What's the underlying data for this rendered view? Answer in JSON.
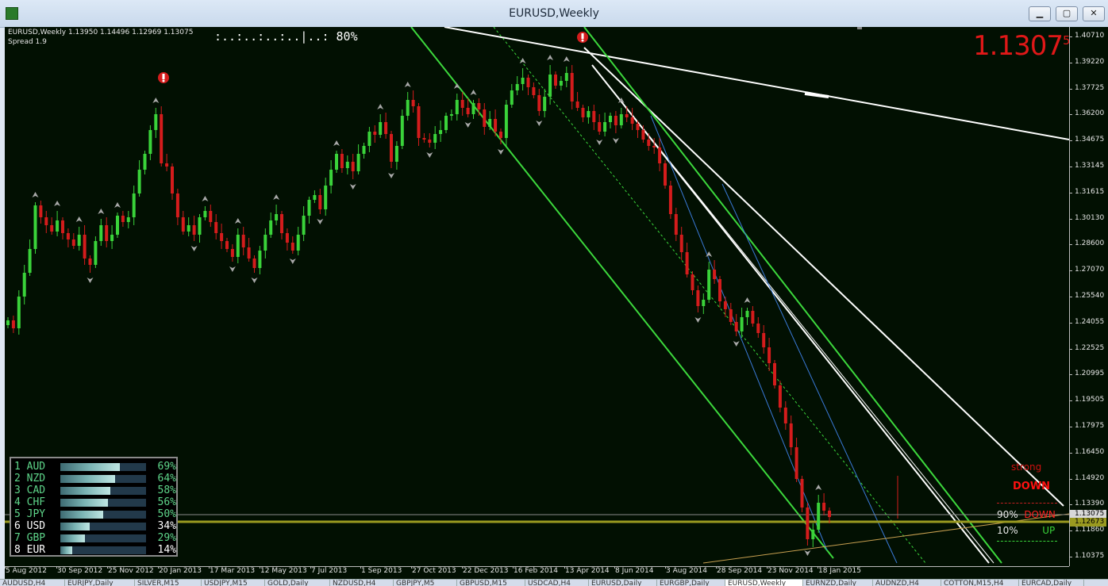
{
  "window": {
    "title": "EURUSD,Weekly",
    "buttons": {
      "minimize": "▁",
      "restore": "▢",
      "close": "✕"
    }
  },
  "chart_header": {
    "symbol_line": "EURUSD,Weekly  1.13950 1.14496 1.12969 1.13075",
    "spread": "Spread 1.9",
    "progress": ":..:..:..:..|..: 80%"
  },
  "big_price": {
    "main": "1.1307",
    "fraction": "5"
  },
  "price_axis": {
    "labels": [
      "1.40710",
      "1.39220",
      "1.37725",
      "1.36200",
      "1.34675",
      "1.33145",
      "1.31615",
      "1.30130",
      "1.28600",
      "1.27070",
      "1.25540",
      "1.24055",
      "1.22525",
      "1.20995",
      "1.19505",
      "1.17975",
      "1.16450",
      "1.14920",
      "1.13390",
      "1.11860",
      "1.10375"
    ],
    "bid_tag": "1.13075",
    "line_tag": "1.12673"
  },
  "time_axis": {
    "labels": [
      "5 Aug 2012",
      "30 Sep 2012",
      "25 Nov 2012",
      "20 Jan 2013",
      "17 Mar 2013",
      "12 May 2013",
      "7 Jul 2013",
      "1 Sep 2013",
      "27 Oct 2013",
      "22 Dec 2013",
      "16 Feb 2014",
      "13 Apr 2014",
      "8 Jun 2014",
      "3 Aug 2014",
      "28 Sep 2014",
      "23 Nov 2014",
      "18 Jan 2015"
    ]
  },
  "currency_strength": [
    {
      "rank": "1",
      "code": "AUD",
      "pct": "69%",
      "value": 0.69,
      "color": "#5ed68a"
    },
    {
      "rank": "2",
      "code": "NZD",
      "pct": "64%",
      "value": 0.64,
      "color": "#5ed68a"
    },
    {
      "rank": "3",
      "code": "CAD",
      "pct": "58%",
      "value": 0.58,
      "color": "#5ed68a"
    },
    {
      "rank": "4",
      "code": "CHF",
      "pct": "56%",
      "value": 0.56,
      "color": "#5ed68a"
    },
    {
      "rank": "5",
      "code": "JPY",
      "pct": "50%",
      "value": 0.5,
      "color": "#5ed68a"
    },
    {
      "rank": "6",
      "code": "USD",
      "pct": "34%",
      "value": 0.34,
      "color": "#ffffff"
    },
    {
      "rank": "7",
      "code": "GBP",
      "pct": "29%",
      "value": 0.29,
      "color": "#5ed68a"
    },
    {
      "rank": "8",
      "code": "EUR",
      "pct": "14%",
      "value": 0.14,
      "color": "#ffffff"
    }
  ],
  "signal": {
    "strength_word": "strong",
    "direction": "DOWN",
    "down_pct": "90%",
    "down_label": "DOWN",
    "up_pct": "10%",
    "up_label": "UP"
  },
  "tabs": [
    "AUDUSD,H4",
    "EURJPY,Daily",
    "SILVER,M15",
    "USDJPY,M15",
    "GOLD,Daily",
    "NZDUSD,H4",
    "GBPJPY,M5",
    "GBPUSD,M15",
    "USDCAD,H4",
    "EURUSD,Daily",
    "EURGBP,Daily",
    "EURUSD,Weekly",
    "EURNZD,Daily",
    "AUDNZD,H4",
    "COTTON,M15,H4",
    "EURCAD,Daily"
  ],
  "active_tab": "EURUSD,Weekly",
  "colors": {
    "background": "#021002",
    "bull": "#3ad33a",
    "bear": "#d41c1c",
    "trend_green": "#3cd83c",
    "trend_white": "#ffffff",
    "channel_blue": "#3a7ad8",
    "support": "#c8a050"
  }
}
